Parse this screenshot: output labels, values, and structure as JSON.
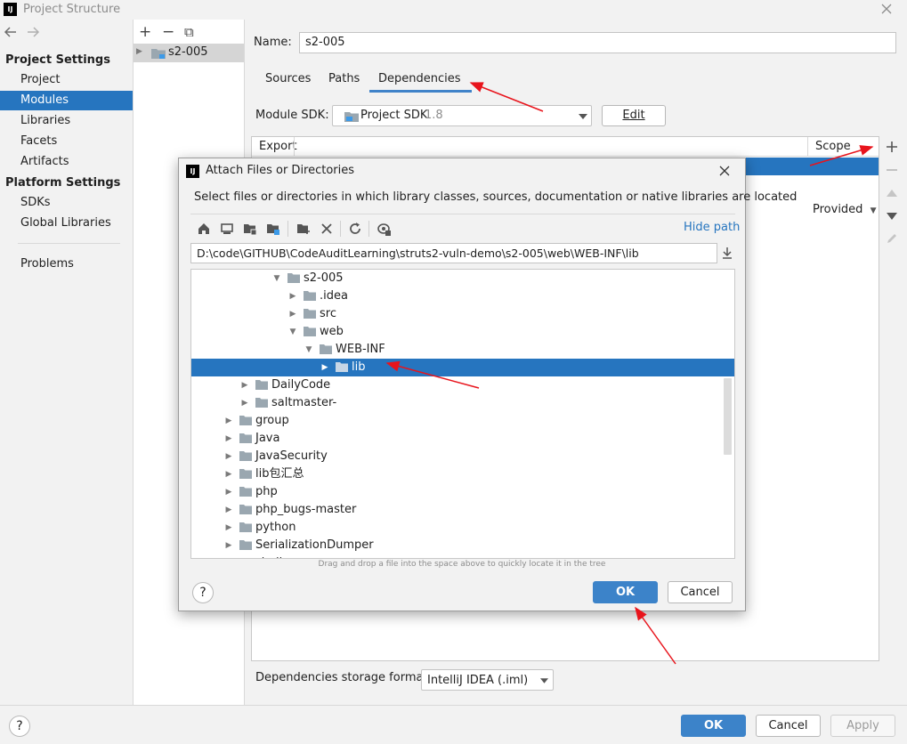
{
  "window": {
    "title": "Project Structure",
    "app_icon": "IJ"
  },
  "nav": {
    "project_settings_header": "Project Settings",
    "project_settings": [
      "Project",
      "Modules",
      "Libraries",
      "Facets",
      "Artifacts"
    ],
    "platform_settings_header": "Platform Settings",
    "platform_settings": [
      "SDKs",
      "Global Libraries"
    ],
    "problems": "Problems"
  },
  "modules": {
    "add": "+",
    "remove": "−",
    "copy": "⧉",
    "module_name": "s2-005"
  },
  "main": {
    "name_label": "Name:",
    "name_value": "s2-005",
    "tabs": [
      "Sources",
      "Paths",
      "Dependencies"
    ],
    "module_sdk_label": "Module SDK:",
    "module_sdk_value": "Project SDK",
    "module_sdk_version": "1.8",
    "edit_button": "Edit",
    "table_header_export": "Export",
    "table_header_scope": "Scope",
    "scope_value": "Provided",
    "storage_format_label": "Dependencies storage format:",
    "storage_format_value": "IntelliJ IDEA (.iml)"
  },
  "dialog": {
    "title": "Attach Files or Directories",
    "description": "Select files or directories in which library classes, sources, documentation or native libraries are located",
    "hide_path": "Hide path",
    "path_value": "D:\\code\\GITHUB\\CodeAuditLearning\\struts2-vuln-demo\\s2-005\\web\\WEB-INF\\lib",
    "drag_hint": "Drag and drop a file into the space above to quickly locate it in the tree",
    "ok": "OK",
    "cancel": "Cancel",
    "tree": [
      {
        "label": "s2-005"
      },
      {
        "label": ".idea"
      },
      {
        "label": "src"
      },
      {
        "label": "web"
      },
      {
        "label": "WEB-INF"
      },
      {
        "label": "lib"
      },
      {
        "label": "DailyCode"
      },
      {
        "label": "saltmaster-"
      },
      {
        "label": "group"
      },
      {
        "label": "Java"
      },
      {
        "label": "JavaSecurity"
      },
      {
        "label": "lib包汇总"
      },
      {
        "label": "php"
      },
      {
        "label": "php_bugs-master"
      },
      {
        "label": "python"
      },
      {
        "label": "SerializationDumper"
      },
      {
        "label": "shell"
      }
    ]
  },
  "footer": {
    "help": "?",
    "ok": "OK",
    "cancel": "Cancel",
    "apply": "Apply"
  },
  "colors": {
    "selection": "#2675bf",
    "accent": "#3c83c9",
    "annotation_arrow": "#e8141c"
  }
}
